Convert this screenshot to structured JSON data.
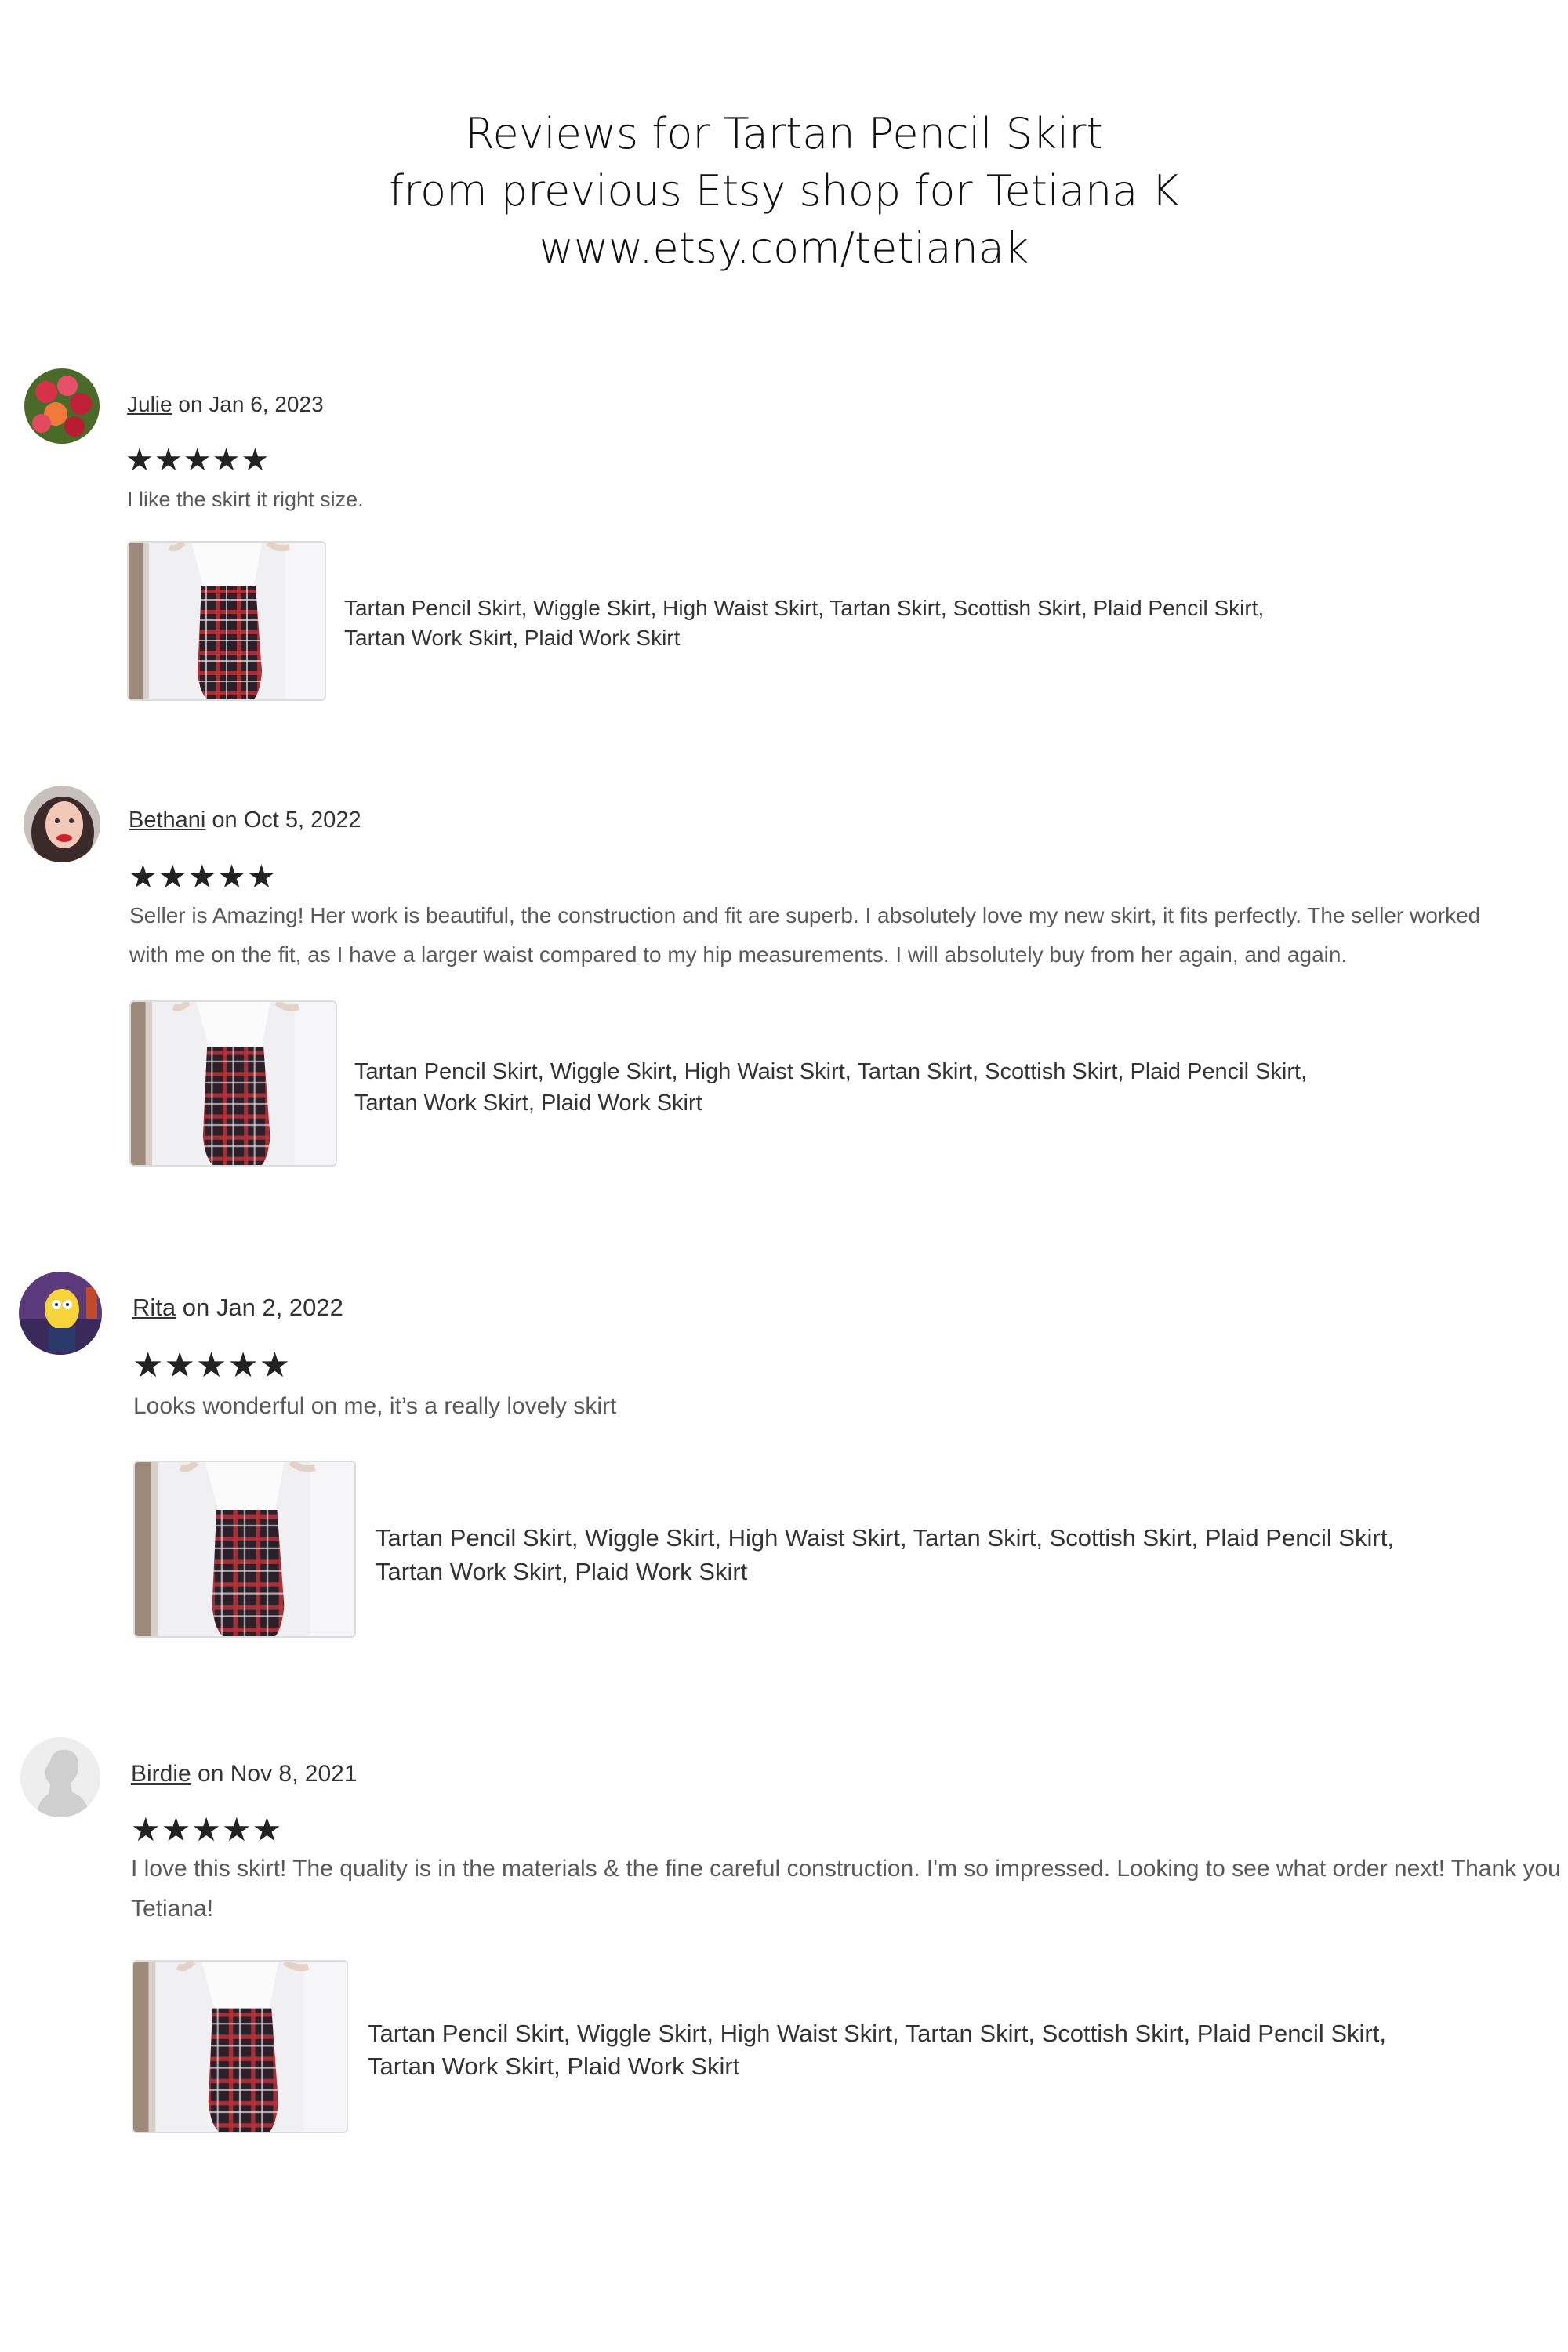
{
  "header": {
    "line1": "Reviews for Tartan Pencil Skirt",
    "line2": "from previous Etsy shop for Tetiana K",
    "line3": "www.etsy.com/tetianak"
  },
  "stars_glyph": "★★★★★",
  "reviews": [
    {
      "name": "Julie",
      "date": "on Jan 6, 2023",
      "rating": 5,
      "text": [
        "I like the skirt it right size."
      ],
      "listing": [
        "Tartan Pencil Skirt, Wiggle Skirt, High Waist Skirt, Tartan Skirt, Scottish Skirt, Plaid Pencil Skirt,",
        "Tartan Work Skirt, Plaid Work Skirt"
      ],
      "avatar_icon": "tulips-avatar-icon"
    },
    {
      "name": "Bethani",
      "date": "on Oct 5, 2022",
      "rating": 5,
      "text": [
        "Seller is Amazing! Her work is beautiful, the construction and fit are superb. I absolutely love my new skirt, it fits perfectly. The seller worked",
        "with me on the fit, as I have a larger waist compared to my hip measurements. I will absolutely buy from her again, and again."
      ],
      "listing": [
        "Tartan Pencil Skirt, Wiggle Skirt, High Waist Skirt, Tartan Skirt, Scottish Skirt, Plaid Pencil Skirt,",
        "Tartan Work Skirt, Plaid Work Skirt"
      ],
      "avatar_icon": "portrait-avatar-icon"
    },
    {
      "name": "Rita",
      "date": "on Jan 2, 2022",
      "rating": 5,
      "text": [
        "Looks wonderful on me, it’s a really lovely skirt"
      ],
      "listing": [
        "Tartan Pencil Skirt, Wiggle Skirt, High Waist Skirt, Tartan Skirt, Scottish Skirt, Plaid Pencil Skirt,",
        "Tartan Work Skirt, Plaid Work Skirt"
      ],
      "avatar_icon": "cartoon-avatar-icon"
    },
    {
      "name": "Birdie",
      "date": "on Nov 8, 2021",
      "rating": 5,
      "text": [
        "I love this skirt! The quality is in the materials & the fine careful construction. I'm so impressed. Looking to see what order next! Thank you",
        "Tetiana!"
      ],
      "listing": [
        "Tartan Pencil Skirt, Wiggle Skirt, High Waist Skirt, Tartan Skirt, Scottish Skirt, Plaid Pencil Skirt,",
        "Tartan Work Skirt, Plaid Work Skirt"
      ],
      "avatar_icon": "default-user-avatar-icon"
    }
  ],
  "colors": {
    "plaid_base": "#2b1f2a",
    "plaid_red": "#b8323a",
    "plaid_white": "#e8e2e2",
    "text_grey": "#595959"
  }
}
